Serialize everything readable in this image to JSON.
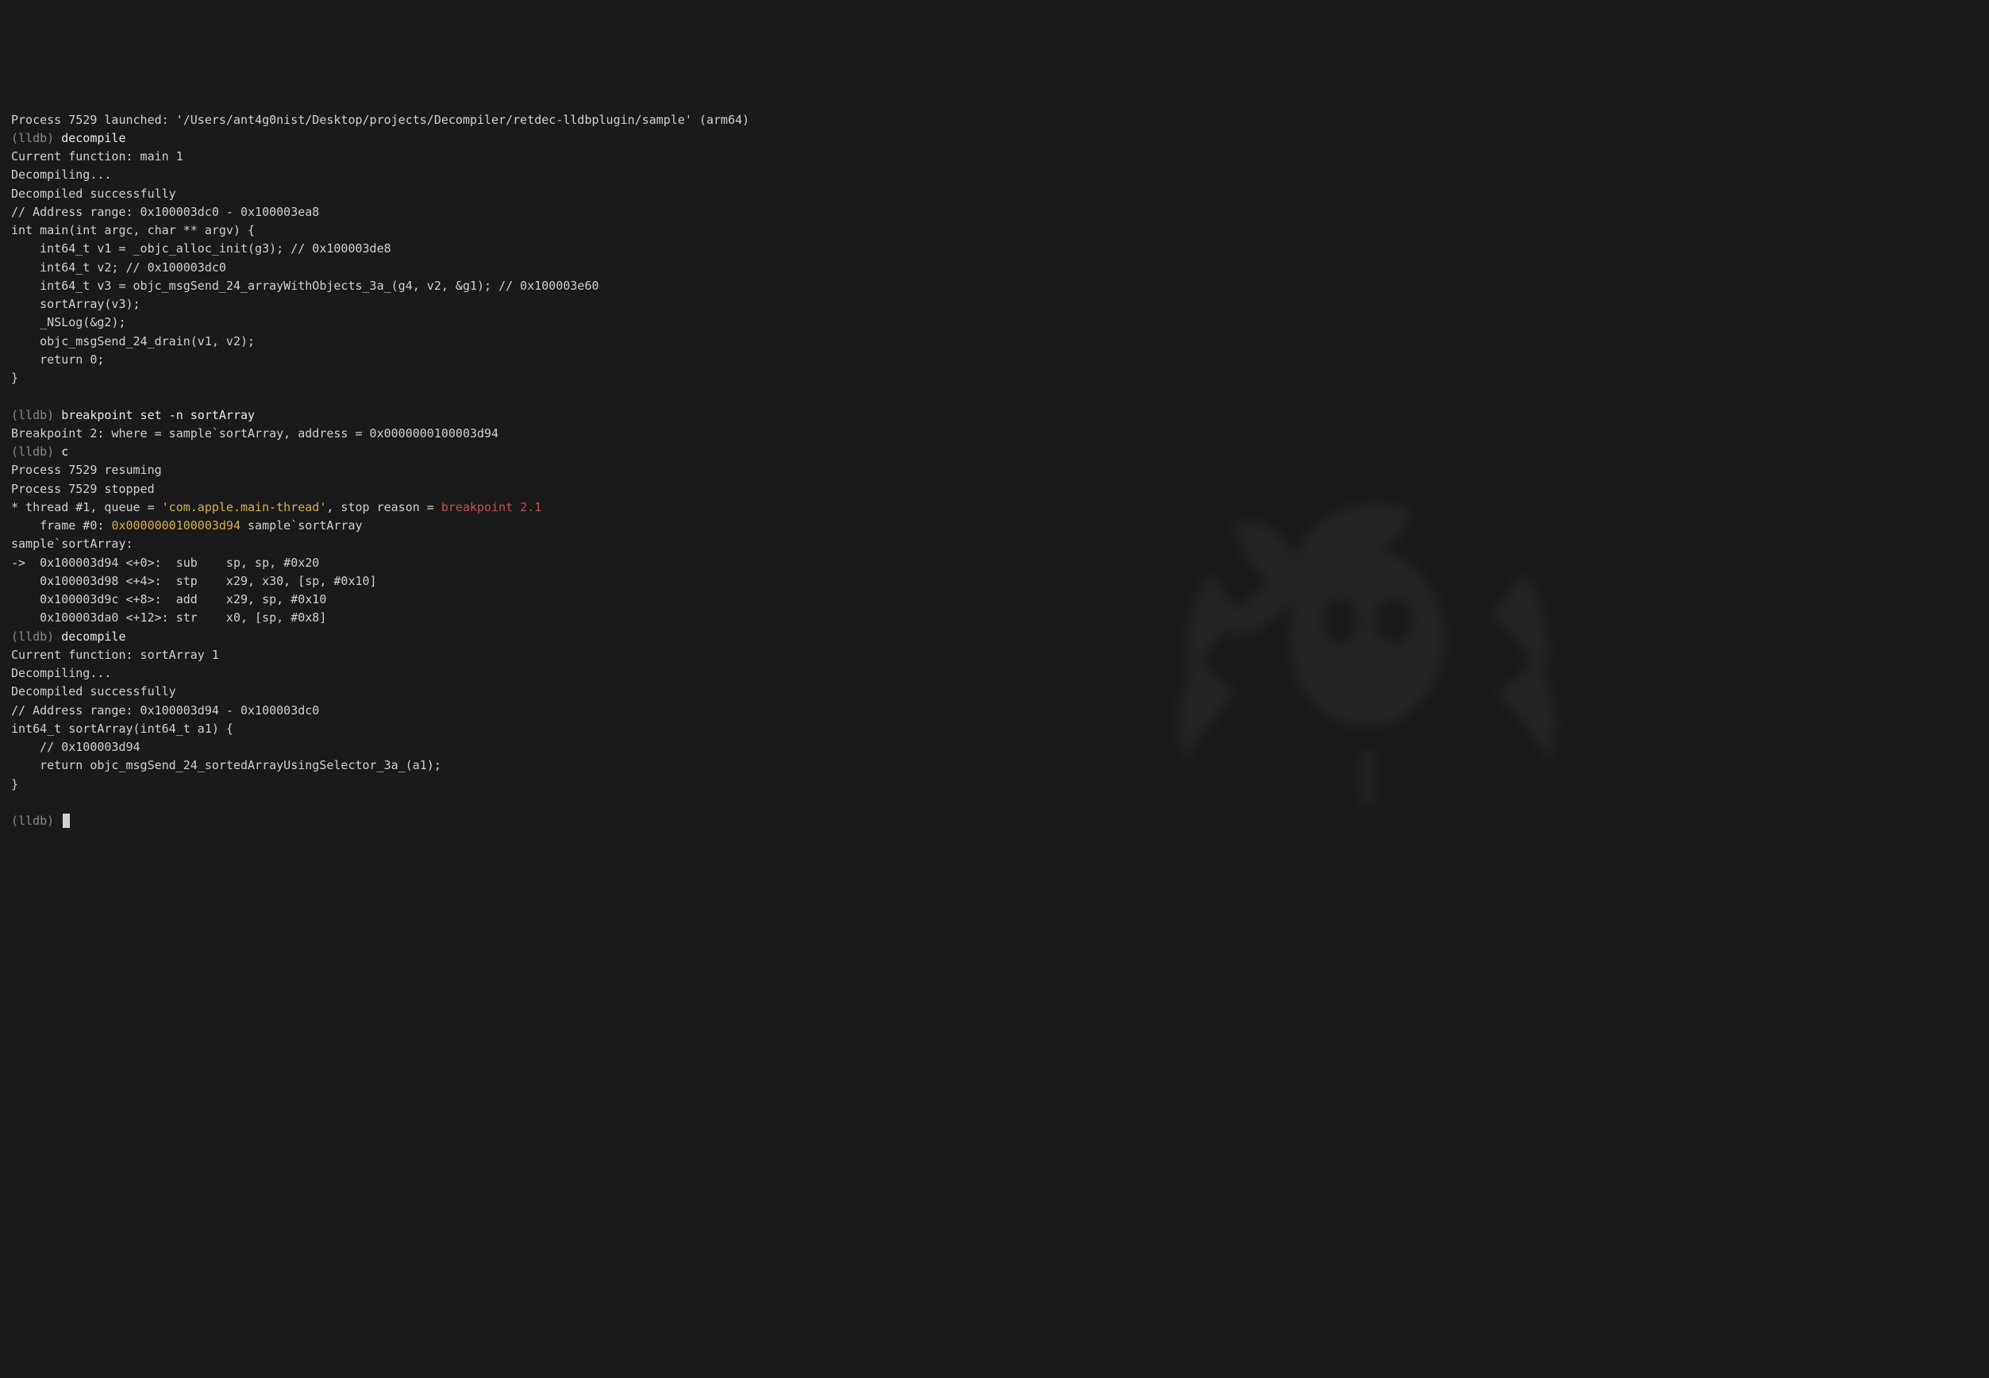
{
  "lines": [
    {
      "segments": [
        {
          "class": "dim",
          "text": "Process 7529 launched: '/Users/ant4g0nist/Desktop/projects/Decompiler/retdec-lldbplugin/sample' (arm64)"
        }
      ]
    },
    {
      "segments": [
        {
          "class": "prompt",
          "text": "(lldb) "
        },
        {
          "class": "command",
          "text": "decompile"
        }
      ]
    },
    {
      "segments": [
        {
          "class": "dim",
          "text": "Current function: main 1"
        }
      ]
    },
    {
      "segments": [
        {
          "class": "dim",
          "text": "Decompiling..."
        }
      ]
    },
    {
      "segments": [
        {
          "class": "dim",
          "text": "Decompiled successfully"
        }
      ]
    },
    {
      "segments": [
        {
          "class": "dim",
          "text": "// Address range: 0x100003dc0 - 0x100003ea8"
        }
      ]
    },
    {
      "segments": [
        {
          "class": "dim",
          "text": "int main(int argc, char ** argv) {"
        }
      ]
    },
    {
      "segments": [
        {
          "class": "dim",
          "text": "    int64_t v1 = _objc_alloc_init(g3); // 0x100003de8"
        }
      ]
    },
    {
      "segments": [
        {
          "class": "dim",
          "text": "    int64_t v2; // 0x100003dc0"
        }
      ]
    },
    {
      "segments": [
        {
          "class": "dim",
          "text": "    int64_t v3 = objc_msgSend_24_arrayWithObjects_3a_(g4, v2, &g1); // 0x100003e60"
        }
      ]
    },
    {
      "segments": [
        {
          "class": "dim",
          "text": "    sortArray(v3);"
        }
      ]
    },
    {
      "segments": [
        {
          "class": "dim",
          "text": "    _NSLog(&g2);"
        }
      ]
    },
    {
      "segments": [
        {
          "class": "dim",
          "text": "    objc_msgSend_24_drain(v1, v2);"
        }
      ]
    },
    {
      "segments": [
        {
          "class": "dim",
          "text": "    return 0;"
        }
      ]
    },
    {
      "segments": [
        {
          "class": "dim",
          "text": "}"
        }
      ]
    },
    {
      "segments": [
        {
          "class": "dim",
          "text": " "
        }
      ]
    },
    {
      "segments": [
        {
          "class": "prompt",
          "text": "(lldb) "
        },
        {
          "class": "command",
          "text": "breakpoint set -n sortArray"
        }
      ]
    },
    {
      "segments": [
        {
          "class": "dim",
          "text": "Breakpoint 2: where = sample`sortArray, address = 0x0000000100003d94"
        }
      ]
    },
    {
      "segments": [
        {
          "class": "prompt",
          "text": "(lldb) "
        },
        {
          "class": "command",
          "text": "c"
        }
      ]
    },
    {
      "segments": [
        {
          "class": "dim",
          "text": "Process 7529 resuming"
        }
      ]
    },
    {
      "segments": [
        {
          "class": "dim",
          "text": "Process 7529 stopped"
        }
      ]
    },
    {
      "segments": [
        {
          "class": "dim",
          "text": "* thread #1, queue = "
        },
        {
          "class": "yellow",
          "text": "'com.apple.main-thread'"
        },
        {
          "class": "dim",
          "text": ", stop reason = "
        },
        {
          "class": "red",
          "text": "breakpoint 2.1"
        }
      ]
    },
    {
      "segments": [
        {
          "class": "dim",
          "text": "    frame #0: "
        },
        {
          "class": "yellow",
          "text": "0x0000000100003d94"
        },
        {
          "class": "dim",
          "text": " sample`sortArray"
        }
      ]
    },
    {
      "segments": [
        {
          "class": "dim",
          "text": "sample`sortArray:"
        }
      ]
    },
    {
      "segments": [
        {
          "class": "dim",
          "text": "->  0x100003d94 <+0>:  sub    sp, sp, #0x20"
        }
      ]
    },
    {
      "segments": [
        {
          "class": "dim",
          "text": "    0x100003d98 <+4>:  stp    x29, x30, [sp, #0x10]"
        }
      ]
    },
    {
      "segments": [
        {
          "class": "dim",
          "text": "    0x100003d9c <+8>:  add    x29, sp, #0x10"
        }
      ]
    },
    {
      "segments": [
        {
          "class": "dim",
          "text": "    0x100003da0 <+12>: str    x0, [sp, #0x8]"
        }
      ]
    },
    {
      "segments": [
        {
          "class": "prompt",
          "text": "(lldb) "
        },
        {
          "class": "command",
          "text": "decompile"
        }
      ]
    },
    {
      "segments": [
        {
          "class": "dim",
          "text": "Current function: sortArray 1"
        }
      ]
    },
    {
      "segments": [
        {
          "class": "dim",
          "text": "Decompiling..."
        }
      ]
    },
    {
      "segments": [
        {
          "class": "dim",
          "text": "Decompiled successfully"
        }
      ]
    },
    {
      "segments": [
        {
          "class": "dim",
          "text": "// Address range: 0x100003d94 - 0x100003dc0"
        }
      ]
    },
    {
      "segments": [
        {
          "class": "dim",
          "text": "int64_t sortArray(int64_t a1) {"
        }
      ]
    },
    {
      "segments": [
        {
          "class": "dim",
          "text": "    // 0x100003d94"
        }
      ]
    },
    {
      "segments": [
        {
          "class": "dim",
          "text": "    return objc_msgSend_24_sortedArrayUsingSelector_3a_(a1);"
        }
      ]
    },
    {
      "segments": [
        {
          "class": "dim",
          "text": "}"
        }
      ]
    },
    {
      "segments": [
        {
          "class": "dim",
          "text": " "
        }
      ]
    }
  ],
  "final_prompt": "(lldb) "
}
